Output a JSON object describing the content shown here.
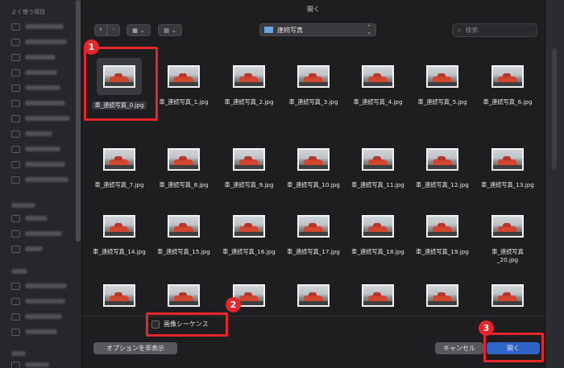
{
  "dialog": {
    "title": "開く",
    "location": "連続写真",
    "search_placeholder": "検索",
    "view_icon": "grid-view-icon",
    "group_icon": "group-icon",
    "checkbox_label": "画像シーケンス",
    "checkbox_checked": false,
    "options_button": "オプションを非表示",
    "cancel_button": "キャンセル",
    "open_button": "開く",
    "selected_file": "車_連続写真_0.jpg"
  },
  "files": [
    {
      "name": "車_連続写真_0.jpg"
    },
    {
      "name": "車_連続写真_1.jpg"
    },
    {
      "name": "車_連続写真_2.jpg"
    },
    {
      "name": "車_連続写真_3.jpg"
    },
    {
      "name": "車_連続写真_4.jpg"
    },
    {
      "name": "車_連続写真_5.jpg"
    },
    {
      "name": "車_連続写真_6.jpg"
    },
    {
      "name": "車_連続写真_7.jpg"
    },
    {
      "name": "車_連続写真_8.jpg"
    },
    {
      "name": "車_連続写真_9.jpg"
    },
    {
      "name": "車_連続写真_10.jpg"
    },
    {
      "name": "車_連続写真_11.jpg"
    },
    {
      "name": "車_連続写真_12.jpg"
    },
    {
      "name": "車_連続写真_13.jpg"
    },
    {
      "name": "車_連続写真_14.jpg"
    },
    {
      "name": "車_連続写真_15.jpg"
    },
    {
      "name": "車_連続写真_16.jpg"
    },
    {
      "name": "車_連続写真_17.jpg"
    },
    {
      "name": "車_連続写真_18.jpg"
    },
    {
      "name": "車_連続写真_19.jpg"
    },
    {
      "name": "車_連続写真\n_20.jpg"
    },
    {
      "name": ""
    },
    {
      "name": ""
    },
    {
      "name": ""
    },
    {
      "name": ""
    },
    {
      "name": ""
    },
    {
      "name": ""
    },
    {
      "name": ""
    }
  ],
  "sidebar": {
    "section_favorites": "よく使う項目"
  },
  "annotations": {
    "badge1": "1",
    "badge2": "2",
    "badge3": "3"
  },
  "colors": {
    "accent": "#2f63c8",
    "annotation": "#e5262b",
    "folder": "#6aa4de"
  }
}
